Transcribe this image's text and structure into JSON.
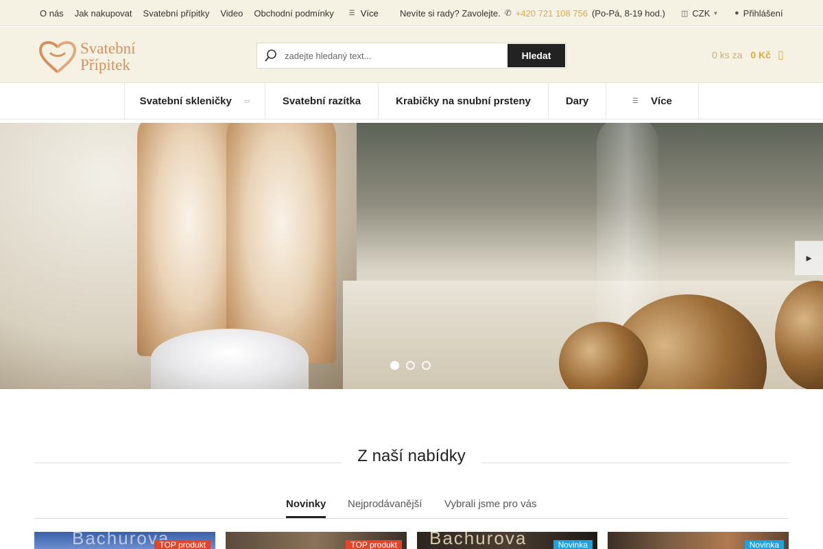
{
  "topbar": {
    "links": [
      "O nás",
      "Jak nakupovat",
      "Svatební přípitky",
      "Video",
      "Obchodní podmínky"
    ],
    "more_label": "Více",
    "contact_text": "Nevíte si rady? Zavolejte.",
    "phone": "+420 721 108 756",
    "hours": "(Po-Pá, 8-19 hod.)",
    "currency": "CZK",
    "login": "Přihlášení"
  },
  "header": {
    "logo_line1": "Svatební",
    "logo_line2": "Přípitek",
    "search_placeholder": "zadejte hledaný text...",
    "search_button": "Hledat",
    "cart_count": "0 ks za",
    "cart_price": "0 Kč"
  },
  "nav": {
    "items": [
      {
        "label": "Svatební skleničky",
        "has_caret": true
      },
      {
        "label": "Svatební razítka"
      },
      {
        "label": "Krabičky na snubní prsteny"
      },
      {
        "label": "Dary"
      },
      {
        "label": "Více"
      }
    ]
  },
  "hero": {
    "slides": 3,
    "active_slide": 1
  },
  "section": {
    "title": "Z naší nabídky",
    "tabs": [
      "Novinky",
      "Nejprodávanější",
      "Vybrali jsme pro vás"
    ],
    "active_tab": "Novinky"
  },
  "products": [
    {
      "badge": "TOP produkt",
      "badge_type": "top",
      "caption": "Bachurova"
    },
    {
      "badge": "TOP produkt",
      "badge_type": "top",
      "caption": ""
    },
    {
      "badge": "Novinka",
      "badge_type": "new",
      "caption": "Bachurova"
    },
    {
      "badge": "Novinka",
      "badge_type": "new",
      "caption": ""
    }
  ],
  "colors": {
    "topbar_bg": "#f6f2e3",
    "accent_gold": "#d4ad4a",
    "logo": "#d4915f",
    "badge_top": "#e2462a",
    "badge_new": "#1da2e0"
  }
}
